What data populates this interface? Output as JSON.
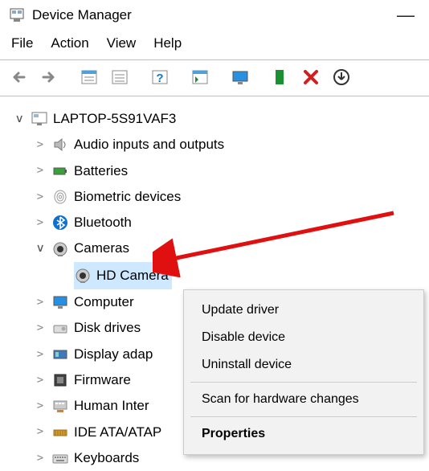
{
  "title": "Device Manager",
  "menubar": {
    "file": "File",
    "action": "Action",
    "view": "View",
    "help": "Help"
  },
  "root": "LAPTOP-5S91VAF3",
  "nodes": {
    "audio": "Audio inputs and outputs",
    "batteries": "Batteries",
    "biometric": "Biometric devices",
    "bluetooth": "Bluetooth",
    "cameras": "Cameras",
    "hdcamera": "HD Camera",
    "computer": "Computer",
    "disk": "Disk drives",
    "display": "Display adap",
    "firmware": "Firmware",
    "hid": "Human Inter",
    "ide": "IDE ATA/ATAP",
    "keyboards": "Keyboards"
  },
  "context": {
    "update": "Update driver",
    "disable": "Disable device",
    "uninstall": "Uninstall device",
    "scan": "Scan for hardware changes",
    "properties": "Properties"
  }
}
